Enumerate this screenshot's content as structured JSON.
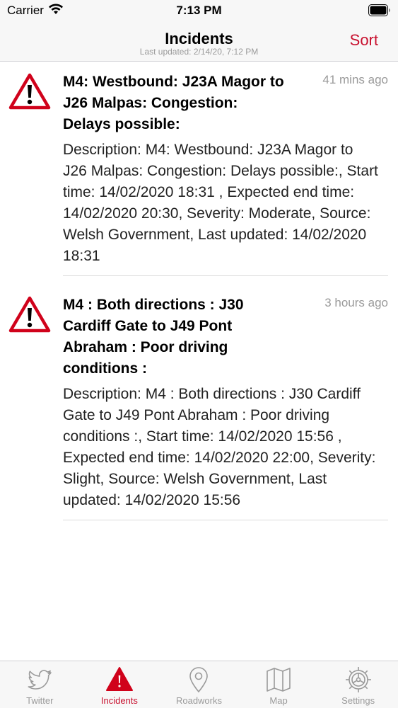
{
  "status_bar": {
    "carrier": "Carrier",
    "time": "7:13 PM"
  },
  "nav": {
    "title": "Incidents",
    "subtitle": "Last updated: 2/14/20, 7:12 PM",
    "sort_label": "Sort"
  },
  "colors": {
    "accent": "#c8102e",
    "muted": "#9a9a9a"
  },
  "incidents": [
    {
      "icon": "warning-icon",
      "title": "M4: Westbound: J23A Magor to J26 Malpas: Congestion: Delays possible:",
      "time": "41 mins ago",
      "description": "Description: M4: Westbound: J23A Magor to J26 Malpas: Congestion: Delays possible:, Start time: 14/02/2020 18:31 , Expected end time: 14/02/2020 20:30, Severity: Moderate, Source: Welsh Government, Last updated: 14/02/2020 18:31"
    },
    {
      "icon": "warning-icon",
      "title": "M4 : Both directions : J30 Cardiff Gate to J49 Pont Abraham : Poor driving conditions :",
      "time": "3 hours ago",
      "description": "Description: M4 : Both directions : J30 Cardiff Gate to J49 Pont Abraham : Poor driving conditions :, Start time: 14/02/2020 15:56 , Expected end time: 14/02/2020 22:00, Severity: Slight, Source: Welsh Government, Last updated: 14/02/2020 15:56"
    }
  ],
  "tabs": [
    {
      "label": "Twitter",
      "icon": "twitter-icon",
      "active": false
    },
    {
      "label": "Incidents",
      "icon": "warning-icon",
      "active": true
    },
    {
      "label": "Roadworks",
      "icon": "map-pin-icon",
      "active": false
    },
    {
      "label": "Map",
      "icon": "map-icon",
      "active": false
    },
    {
      "label": "Settings",
      "icon": "gear-icon",
      "active": false
    }
  ]
}
